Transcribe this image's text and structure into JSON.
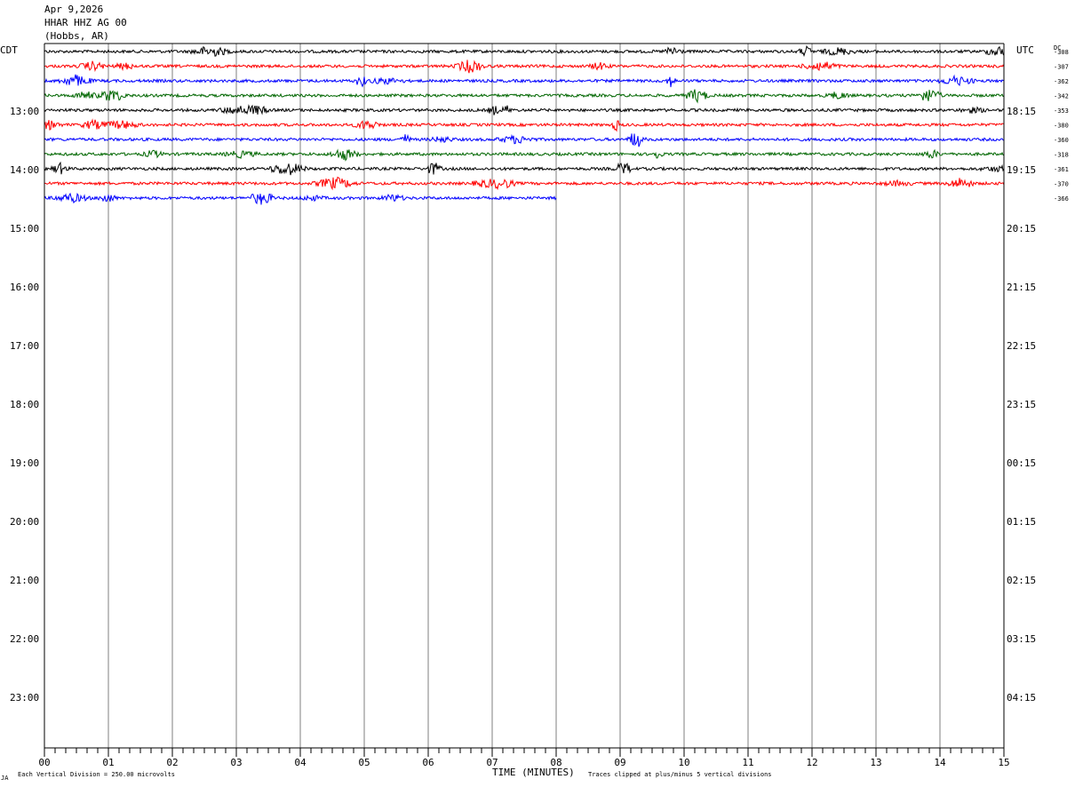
{
  "header": {
    "date": "Apr 9,2026",
    "station": "HHAR HHZ AG 00",
    "location": "(Hobbs, AR)"
  },
  "left_label": "CDT",
  "right_label": "UTC",
  "dc_label": "DC",
  "footer": {
    "scale_note": "Each Vertical Division =  250.00 microvolts",
    "axis_title": "TIME (MINUTES)",
    "clip_note": "Traces clipped at plus/minus 5 vertical divisions",
    "corner_mark": "JA"
  },
  "chart_data": {
    "type": "line",
    "subtype": "helicorder",
    "minutes_per_line": 15,
    "x_range": [
      0,
      15
    ],
    "x_ticks": [
      "00",
      "01",
      "02",
      "03",
      "04",
      "05",
      "06",
      "07",
      "08",
      "09",
      "10",
      "11",
      "12",
      "13",
      "14",
      "15"
    ],
    "left_time_labels": [
      "13:00",
      "14:00",
      "15:00",
      "16:00",
      "17:00",
      "18:00",
      "19:00",
      "20:00",
      "21:00",
      "22:00",
      "23:00"
    ],
    "right_time_labels": [
      "18:15",
      "19:15",
      "20:15",
      "21:15",
      "22:15",
      "23:15",
      "00:15",
      "01:15",
      "02:15",
      "03:15",
      "04:15"
    ],
    "trace_colors": [
      "#000000",
      "#ff0000",
      "#0000ff",
      "#006600"
    ],
    "traces": [
      {
        "dc": "-308",
        "end_minute": 15
      },
      {
        "dc": "-307",
        "end_minute": 15
      },
      {
        "dc": "-362",
        "end_minute": 15
      },
      {
        "dc": "-342",
        "end_minute": 15
      },
      {
        "dc": "-353",
        "end_minute": 15
      },
      {
        "dc": "-380",
        "end_minute": 15
      },
      {
        "dc": "-360",
        "end_minute": 15
      },
      {
        "dc": "-318",
        "end_minute": 15
      },
      {
        "dc": "-361",
        "end_minute": 15
      },
      {
        "dc": "-370",
        "end_minute": 15
      },
      {
        "dc": "-366",
        "end_minute": 8
      }
    ],
    "grid": true
  }
}
